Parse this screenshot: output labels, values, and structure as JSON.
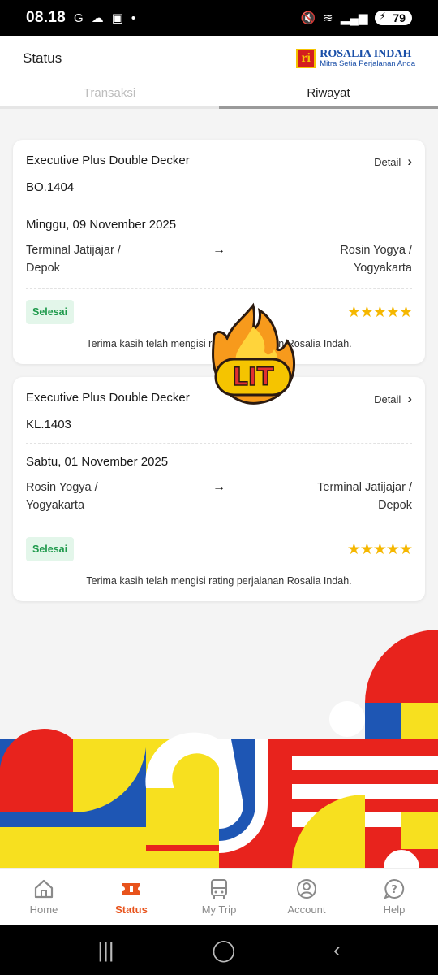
{
  "status_bar": {
    "time": "08.18",
    "battery": "79"
  },
  "header": {
    "title": "Status",
    "logo_name": "ROSALIA INDAH",
    "logo_tagline": "Mitra Setia Perjalanan Anda",
    "logo_mark": "ri"
  },
  "tabs": [
    {
      "label": "Transaksi",
      "active": false
    },
    {
      "label": "Riwayat",
      "active": true
    }
  ],
  "trips": [
    {
      "class": "Executive Plus Double Decker",
      "detail_label": "Detail",
      "code": "BO.1404",
      "date": "Minggu, 09 November 2025",
      "from_line1": "Terminal Jatijajar /",
      "from_line2": "Depok",
      "to_line1": "Rosin Yogya /",
      "to_line2": "Yogyakarta",
      "status": "Selesai",
      "rating": 5,
      "stars": "★★★★★",
      "thanks": "Terima kasih telah mengisi rating perjalanan Rosalia Indah."
    },
    {
      "class": "Executive Plus Double Decker",
      "detail_label": "Detail",
      "code": "KL.1403",
      "date": "Sabtu, 01 November 2025",
      "from_line1": "Rosin Yogya /",
      "from_line2": "Yogyakarta",
      "to_line1": "Terminal Jatijajar /",
      "to_line2": "Depok",
      "status": "Selesai",
      "rating": 5,
      "stars": "★★★★★",
      "thanks": "Terima kasih telah mengisi rating perjalanan Rosalia Indah."
    }
  ],
  "sticker": {
    "text": "LIT"
  },
  "bottom_nav": [
    {
      "label": "Home",
      "icon": "home-icon",
      "active": false
    },
    {
      "label": "Status",
      "icon": "ticket-icon",
      "active": true
    },
    {
      "label": "My Trip",
      "icon": "bus-icon",
      "active": false
    },
    {
      "label": "Account",
      "icon": "account-icon",
      "active": false
    },
    {
      "label": "Help",
      "icon": "help-icon",
      "active": false
    }
  ],
  "colors": {
    "accent": "#e8531c",
    "status_green": "#1f9a4c",
    "star": "#f5b700",
    "brand_blue": "#1a4fa8",
    "brand_red": "#d41e1e",
    "brand_yellow": "#f5c400"
  }
}
